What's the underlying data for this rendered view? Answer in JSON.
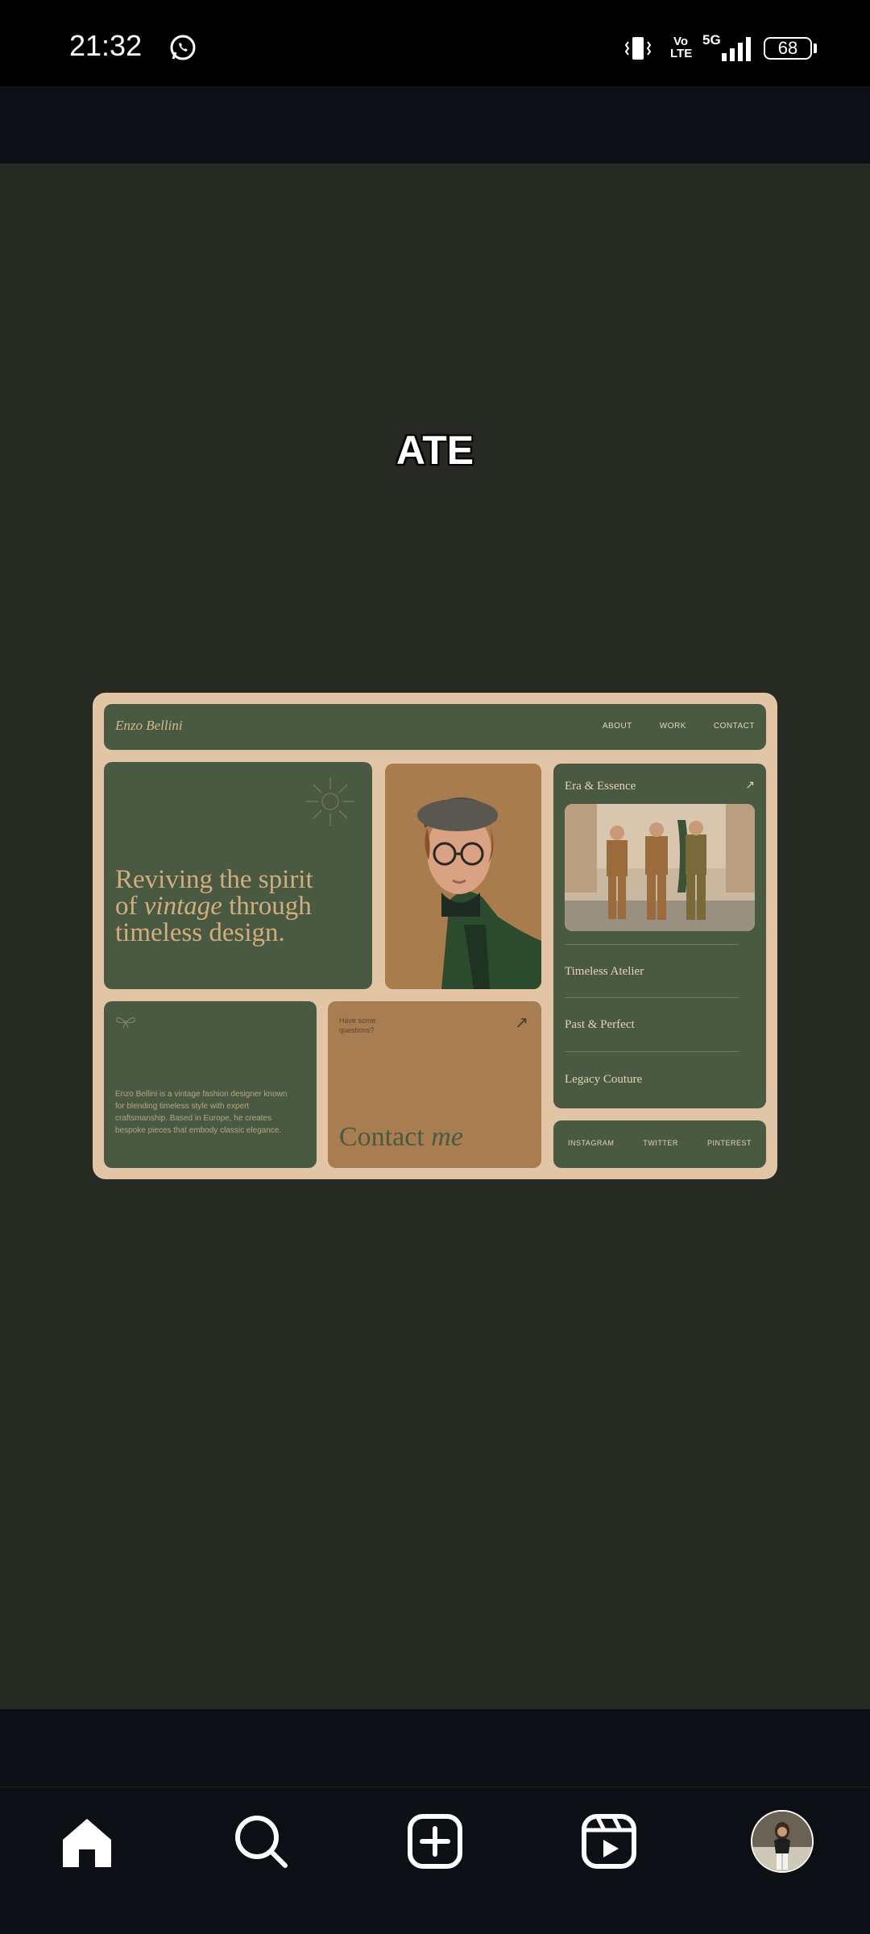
{
  "status_bar": {
    "time": "21:32",
    "network_volte": "Vo LTE",
    "network_type": "5G",
    "battery": "68",
    "icons": [
      "whatsapp-icon",
      "vibrate-icon",
      "signal-icon",
      "battery-icon"
    ]
  },
  "reel": {
    "caption": "ATE",
    "mockup": {
      "brand": "Enzo Bellini",
      "nav": [
        "ABOUT",
        "WORK",
        "CONTACT"
      ],
      "hero_line1": "Reviving the spirit",
      "hero_line2_pre": "of ",
      "hero_line2_em": "vintage",
      "hero_line2_post": " through",
      "hero_line3": "timeless design.",
      "collection_title": "Era & Essence",
      "collections": [
        "Timeless Atelier",
        "Past & Perfect",
        "Legacy Couture"
      ],
      "about_text": "Enzo Bellini is a vintage fashion designer known for blending timeless style with expert craftsmanship. Based in Europe, he creates bespoke pieces that embody classic elegance.",
      "contact_question": "Have some questions?",
      "contact_title": "Contact",
      "contact_title_em": "me",
      "social": [
        "INSTAGRAM",
        "TWITTER",
        "PINTEREST"
      ]
    }
  },
  "bottom_nav": {
    "items": [
      "home-icon",
      "search-icon",
      "create-icon",
      "reels-icon",
      "profile-avatar"
    ]
  },
  "colors": {
    "page_bg": "#0c1015",
    "video_bg": "#272a22",
    "mock_frame": "#e1c5a5",
    "mock_green": "#4a5a42",
    "mock_tan": "#a87d52"
  }
}
